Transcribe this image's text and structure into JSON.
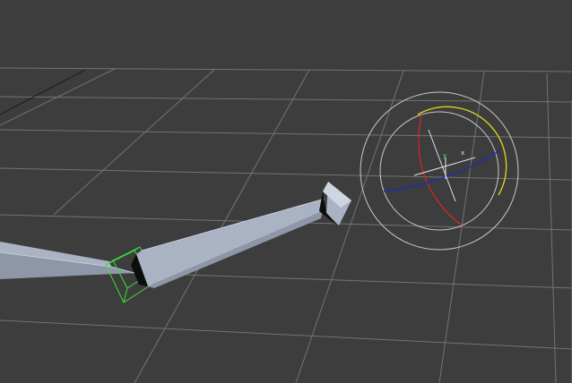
{
  "viewport": {
    "background_color": "#3d3d3d",
    "grid_color": "#737373",
    "grid_dark_line_color": "#1f1f1f"
  },
  "bones": {
    "fill_color": "#aab3c4",
    "shade_color": "#8e97a8",
    "edge_color": "#cfd6e3",
    "dark_face_color": "#0d0d0d",
    "selection_box_color": "#3adf3a"
  },
  "rotate_gizmo": {
    "outer_ring_color": "#c8c8c8",
    "x_axis_color": "#c42a2a",
    "y_axis_color": "#d8d020",
    "z_axis_color": "#1f2fa8",
    "center_cross_color": "#e6e6e6",
    "axis_y_label": "y",
    "axis_x_label": "x",
    "axis_y_label_color": "#5fe05f",
    "axis_x_label_color": "#e6e6e6"
  }
}
